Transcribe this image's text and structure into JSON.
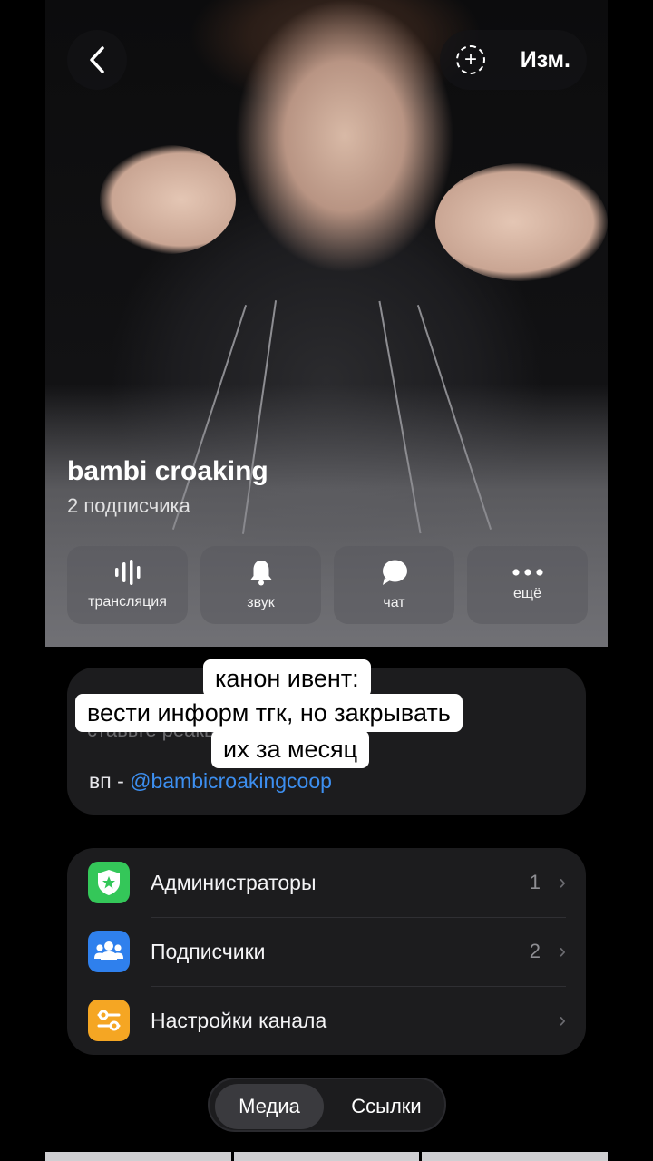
{
  "header": {
    "back_icon": "chevron-left-icon",
    "edit_label": "Изм.",
    "add_icon": "add-story-icon"
  },
  "channel": {
    "name": "bambi croaking",
    "subscribers": "2 подписчика"
  },
  "actions": [
    {
      "label": "трансляция",
      "icon": "broadcast-icon"
    },
    {
      "label": "звук",
      "icon": "bell-icon"
    },
    {
      "label": "чат",
      "icon": "chat-icon"
    },
    {
      "label": "ещё",
      "icon": "more-icon"
    }
  ],
  "description": {
    "hidden_text": "ставьте реакции",
    "vp_prefix": "вп - ",
    "vp_link": "@bambicroakingcoop"
  },
  "overlay": {
    "line1": "канон ивент:",
    "line2": "вести информ тгк, но закрывать",
    "line3": "их за месяц"
  },
  "list": [
    {
      "title": "Администраторы",
      "count": "1",
      "icon": "shield-star-icon",
      "color": "#34c759"
    },
    {
      "title": "Подписчики",
      "count": "2",
      "icon": "people-icon",
      "color": "#2f80ed"
    },
    {
      "title": "Настройки канала",
      "count": "",
      "icon": "settings-sliders-icon",
      "color": "#f5a623"
    }
  ],
  "tabs": {
    "media": "Медиа",
    "links": "Ссылки"
  }
}
